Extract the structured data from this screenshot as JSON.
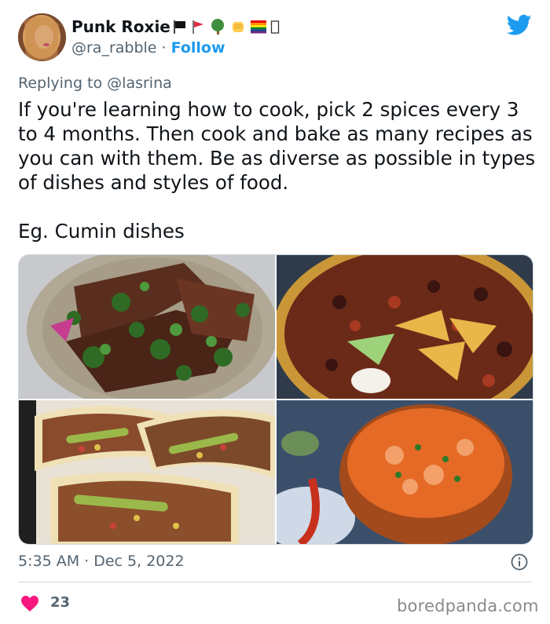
{
  "author": {
    "name": "Punk Roxie",
    "handle": "@ra_rabble",
    "separator": "·",
    "follow_label": "Follow",
    "name_emojis": [
      "black-flag",
      "red-flag",
      "tree",
      "raised-fist",
      "rainbow-flag",
      "unknown-glyph"
    ]
  },
  "reply": {
    "prefix": "Replying to",
    "mention": "@lasrina"
  },
  "tweet": {
    "text": "If you're learning how to cook, pick 2 spices every 3 to 4 months. Then cook and bake as many recipes as you can with them. Be as diverse as possible in types of dishes and styles of food.\n\nEg. Cumin dishes"
  },
  "media": [
    {
      "name": "grilled-steak-with-herbs"
    },
    {
      "name": "bowl-of-chili-with-chips"
    },
    {
      "name": "tacos-with-vegetables"
    },
    {
      "name": "shrimp-stew-bowl"
    }
  ],
  "meta": {
    "timestamp": "5:35 AM · Dec 5, 2022",
    "likes": "23"
  },
  "watermark": "boredpanda.com",
  "colors": {
    "accent": "#1d9bf0",
    "text": "#0f1419",
    "secondary": "#536471",
    "heart": "#f91880"
  }
}
